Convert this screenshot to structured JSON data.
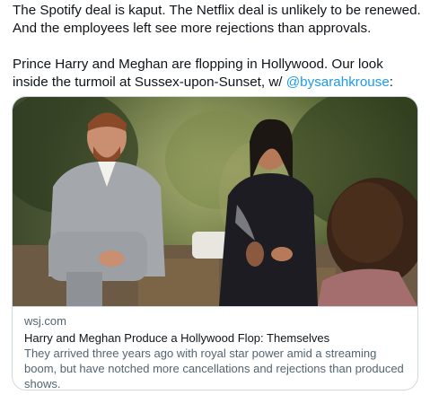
{
  "tweet": {
    "paragraph1": "The Spotify deal is kaput. The Netflix deal is unlikely to be renewed. And the employees left see more rejections than approvals.",
    "paragraph2_before": "Prince Harry and Meghan are flopping in Hollywood. Our look inside the turmoil at Sussex-upon-Sunset, w/ ",
    "mention": "@bysarahkrouse",
    "paragraph2_after": ":"
  },
  "card": {
    "domain": "wsj.com",
    "title": "Harry and Meghan Produce a Hollywood Flop: Themselves",
    "description": "They arrived three years ago with royal star power amid a streaming boom, but have notched more cancellations and rejections than produced shows."
  },
  "colors": {
    "link": "#1d9bf0",
    "text": "#0f1419",
    "secondary_text": "#536471",
    "card_border": "#cfd9de"
  }
}
